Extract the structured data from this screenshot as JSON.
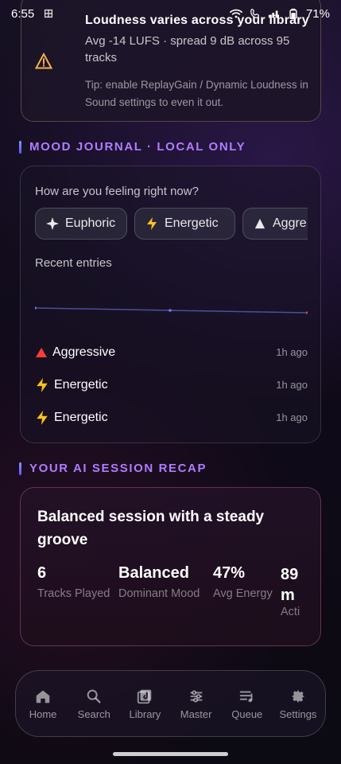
{
  "status": {
    "time": "6:55",
    "battery": "71%"
  },
  "top_card": {
    "title": "Loudness varies across your library",
    "subtitle": "Avg -14 LUFS · spread 9 dB across 95 tracks",
    "tip": "Tip: enable ReplayGain / Dynamic Loudness in Sound settings to even it out."
  },
  "sections": {
    "mood_journal": "MOOD JOURNAL · LOCAL ONLY",
    "recap": "YOUR AI SESSION RECAP"
  },
  "mood": {
    "question": "How are you feeling right now?",
    "chips": [
      {
        "label": "Euphoric",
        "icon": "sparkle-icon"
      },
      {
        "label": "Energetic",
        "icon": "bolt-icon"
      },
      {
        "label": "Aggre",
        "icon": "triangle-icon"
      }
    ],
    "recent_label": "Recent entries",
    "entries": [
      {
        "label": "Aggressive",
        "icon": "triangle-icon",
        "ago": "1h ago"
      },
      {
        "label": "Energetic",
        "icon": "bolt-icon",
        "ago": "1h ago"
      },
      {
        "label": "Energetic",
        "icon": "bolt-icon",
        "ago": "1h ago"
      }
    ]
  },
  "recap": {
    "title": "Balanced session with a steady groove",
    "stats": [
      {
        "value": "6",
        "label": "Tracks Played"
      },
      {
        "value": "Balanced",
        "label": "Dominant Mood"
      },
      {
        "value": "47%",
        "label": "Avg Energy"
      },
      {
        "value": "89\nm",
        "label": "Acti"
      }
    ]
  },
  "nav": {
    "items": [
      {
        "label": "Home",
        "icon": "home-icon"
      },
      {
        "label": "Search",
        "icon": "search-icon"
      },
      {
        "label": "Library",
        "icon": "library-icon"
      },
      {
        "label": "Master",
        "icon": "sliders-icon"
      },
      {
        "label": "Queue",
        "icon": "queue-icon"
      },
      {
        "label": "Settings",
        "icon": "gear-icon"
      }
    ]
  },
  "colors": {
    "accent": "#b07cff",
    "warning": "#f2b04b",
    "aggressive": "#ff3b3b",
    "energetic": "#ffc21a"
  }
}
